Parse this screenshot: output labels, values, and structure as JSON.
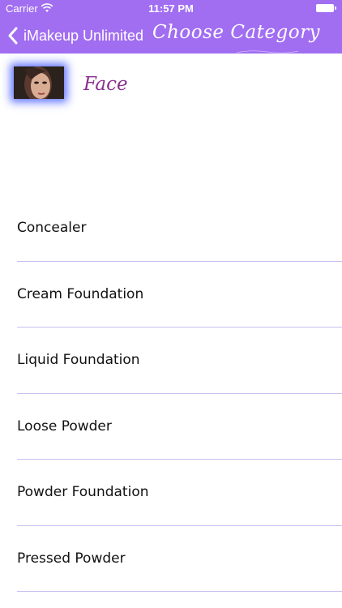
{
  "status": {
    "carrier": "Carrier",
    "time": "11:57 PM"
  },
  "nav": {
    "back_label": "iMakeup Unlimited",
    "title": "Choose Category"
  },
  "section": {
    "title": "Face"
  },
  "items": [
    {
      "label": "Concealer"
    },
    {
      "label": "Cream Foundation"
    },
    {
      "label": "Liquid Foundation"
    },
    {
      "label": "Loose Powder"
    },
    {
      "label": "Powder Foundation"
    },
    {
      "label": "Pressed Powder"
    }
  ],
  "colors": {
    "bar": "#a16ef2",
    "section_title": "#8a2f8f",
    "separator": "#c8bff0"
  },
  "icons": [
    "wifi-icon",
    "battery-icon",
    "back-chevron-icon"
  ]
}
